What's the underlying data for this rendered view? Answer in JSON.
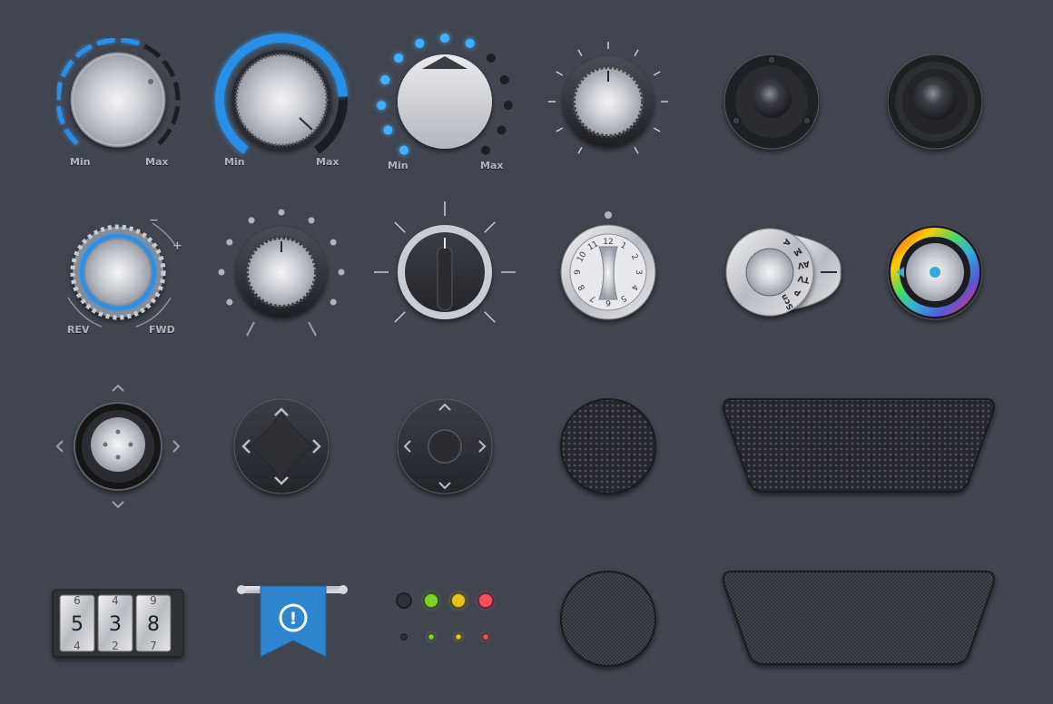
{
  "colors": {
    "background": "#41454f",
    "accent_blue": "#2b8fe6",
    "led_blue": "#3fb1ff",
    "led_green": "#7bd12b",
    "led_yellow": "#e5c21c",
    "led_red": "#ff4d5e",
    "banner_blue": "#2f86cf"
  },
  "knob_vol_ring": {
    "min_label": "Min",
    "max_label": "Max",
    "level": 0.55
  },
  "knob_vol_arc": {
    "min_label": "Min",
    "max_label": "Max",
    "level": 0.8
  },
  "knob_vol_leds": {
    "min_label": "Min",
    "max_label": "Max",
    "lit_dots": 8,
    "total_dots": 13
  },
  "knob_rev_fwd": {
    "rev_label": "REV",
    "fwd_label": "FWD",
    "minus_label": "−",
    "plus_label": "+"
  },
  "mode_dial": {
    "modes": [
      "A",
      "M",
      "AV",
      "TV",
      "P",
      "Scn"
    ]
  },
  "clock_dial": {
    "numbers": [
      "12",
      "1",
      "2",
      "3",
      "4",
      "5",
      "6",
      "7",
      "8",
      "9",
      "10",
      "11"
    ]
  },
  "combination_lock": {
    "digits": [
      "5",
      "3",
      "8"
    ],
    "above": [
      "6",
      "4",
      "9"
    ],
    "below": [
      "4",
      "2",
      "7"
    ]
  },
  "banner": {
    "icon": "exclamation-icon",
    "glyph": "!"
  },
  "leds": {
    "colors": [
      "off",
      "green",
      "yellow",
      "red"
    ]
  },
  "icons": {
    "up": "chevron-up-icon",
    "down": "chevron-down-icon",
    "left": "chevron-left-icon",
    "right": "chevron-right-icon"
  }
}
